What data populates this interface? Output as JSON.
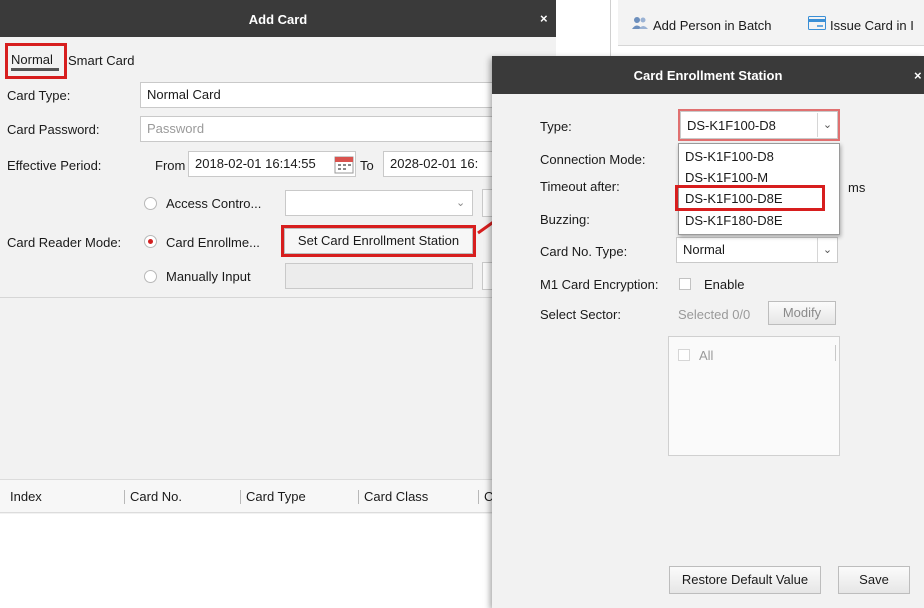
{
  "add_card": {
    "title": "Add Card",
    "close": "×",
    "tabs": {
      "normal": "Normal",
      "smart": "Smart Card"
    },
    "card_type": {
      "label": "Card Type:",
      "value": "Normal Card"
    },
    "card_password": {
      "label": "Card Password:",
      "placeholder": "Password"
    },
    "effective_period": {
      "label": "Effective Period:",
      "from_label": "From",
      "from_value": "2018-02-01 16:14:55",
      "to_label": "To",
      "to_value": "2028-02-01 16:"
    },
    "card_reader_mode": {
      "label": "Card Reader Mode:",
      "access_controller": "Access Contro...",
      "card_enrollment": "Card Enrollme...",
      "manually_input": "Manually Input",
      "set_station_button": "Set Card Enrollment Station"
    },
    "table_headers": [
      "Index",
      "Card No.",
      "Card Type",
      "Card Class",
      "C"
    ]
  },
  "background_window": {
    "add_person_batch": "Add Person in Batch",
    "issue_card": "Issue Card in I"
  },
  "enrollment_station": {
    "title": "Card Enrollment Station",
    "close": "×",
    "type_label": "Type:",
    "type_value": "DS-K1F100-D8",
    "type_options": [
      "DS-K1F100-D8",
      "DS-K1F100-M",
      "DS-K1F100-D8E",
      "DS-K1F180-D8E"
    ],
    "highlighted_option": "DS-K1F100-D8E",
    "connection_mode_label": "Connection Mode:",
    "timeout_label": "Timeout after:",
    "timeout_unit": "ms",
    "buzzing_label": "Buzzing:",
    "card_no_type_label": "Card No. Type:",
    "card_no_type_value": "Normal",
    "m1_encryption_label": "M1 Card Encryption:",
    "m1_enable_label": "Enable",
    "select_sector_label": "Select Sector:",
    "selected_count": "Selected 0/0",
    "modify_button": "Modify",
    "all_label": "All",
    "restore_button": "Restore Default Value",
    "save_button": "Save"
  },
  "colors": {
    "highlight_red": "#d71e1e",
    "titlebar": "#3a3a3a",
    "radio_red": "#d21f1f"
  }
}
